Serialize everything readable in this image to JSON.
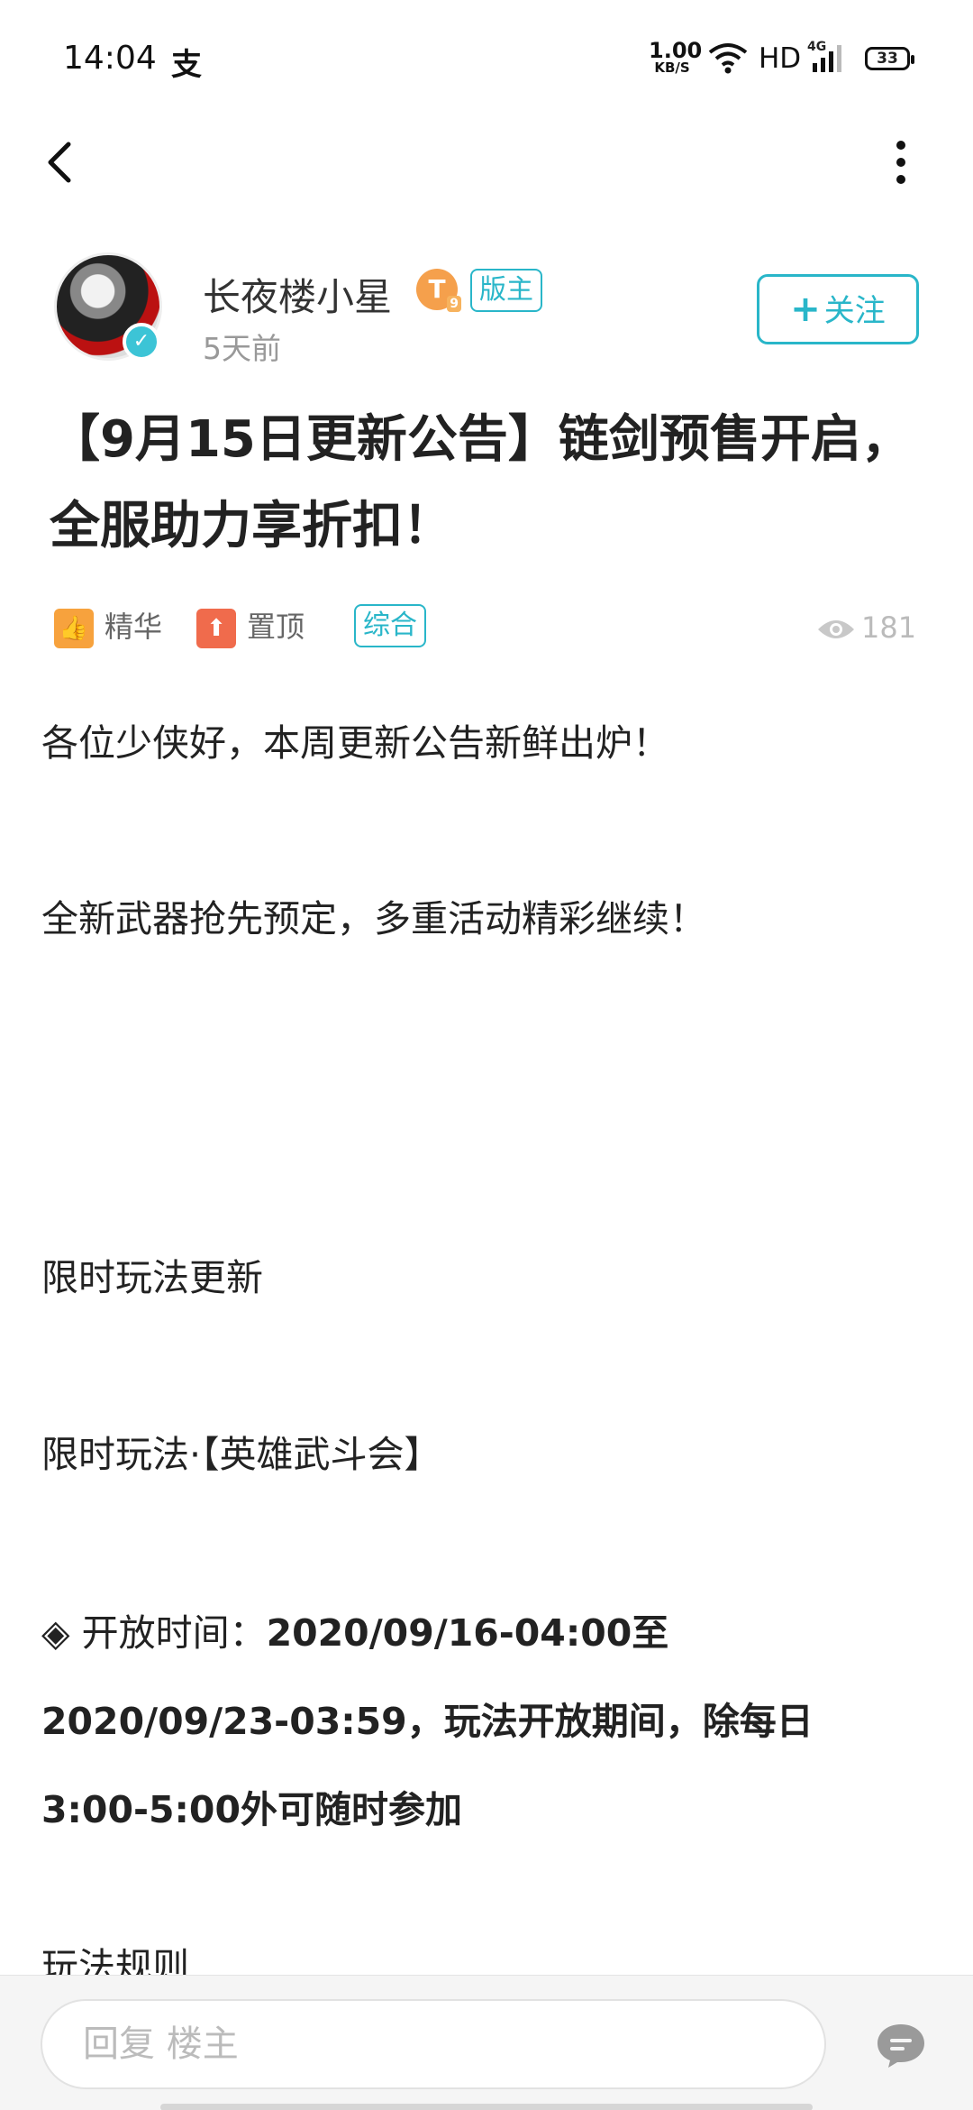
{
  "status_bar": {
    "time": "14:04",
    "app_icon": "支",
    "speed_value": "1.00",
    "speed_unit": "KB/S",
    "network_hd": "HD",
    "network_gen": "4G",
    "battery": "33"
  },
  "author": {
    "name": "长夜楼小星",
    "level": "T",
    "level_sub": "9",
    "role_badge": "版主",
    "posted_ago": "5天前",
    "follow_label": "关注",
    "follow_plus": "+"
  },
  "post": {
    "title": "【9月15日更新公告】链剑预售开启，全服助力享折扣！",
    "tags": {
      "essence": "精华",
      "pinned": "置顶",
      "category": "综合"
    },
    "view_count": "181",
    "body": {
      "greeting": "各位少侠好，本周更新公告新鲜出炉！",
      "intro": "全新武器抢先预定，多重活动精彩继续！",
      "section_heading": "限时玩法更新",
      "event_name": "限时玩法·【英雄武斗会】",
      "open_time_label": "◈ 开放时间：",
      "open_time_line1": "2020/09/16-04:00至",
      "open_time_line2": "2020/09/23-03:59，玩法开放期间，除每日",
      "open_time_line3": "3:00-5:00外可随时参加",
      "next_heading_partial": "玩法规则"
    }
  },
  "reply_bar": {
    "placeholder": "回复  楼主"
  }
}
